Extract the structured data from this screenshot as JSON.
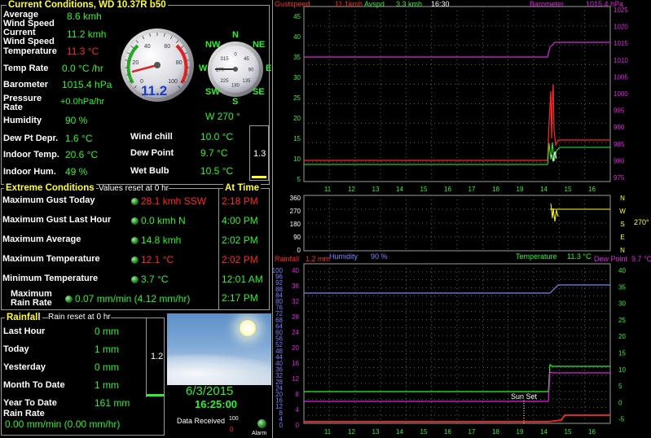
{
  "current": {
    "title": "Current Conditions, WD 10.37R b50",
    "avg_wind_label": "Average\nWind Speed",
    "avg_wind_value": "8.6 kmh",
    "cur_wind_label": "Current\nWind Speed",
    "cur_wind_value": "11.2 kmh",
    "temp_label": "Temperature",
    "temp_value": "11.3 °C",
    "temp_rate_label": "Temp Rate",
    "temp_rate_value": "0.0 °C /hr",
    "baro_label": "Barometer",
    "baro_value": "1015.4 hPa",
    "press_rate_label": "Pressure\nRate",
    "press_rate_value": "+0.0hPa/hr",
    "humidity_label": "Humidity",
    "humidity_value": "90 %",
    "wind_dir_value": "W  270 °",
    "dewdep_label": "Dew Pt Depr.",
    "dewdep_value": "1.6 °C",
    "windchill_label": "Wind chill",
    "windchill_value": "10.0 °C",
    "indoortemp_label": "Indoor Temp.",
    "indoortemp_value": "20.6 °C",
    "dewpoint_label": "Dew Point",
    "dewpoint_value": "9.7 °C",
    "indoorhum_label": "Indoor Hum.",
    "indoorhum_value": "49 %",
    "wetbulb_label": "Wet Bulb",
    "wetbulb_value": "10.5 °C",
    "bar_value": "1.3",
    "speed_gauge": {
      "value": "11.2",
      "reading": 11.2,
      "ticks": [
        "0",
        "20",
        "40",
        "60",
        "80",
        "100"
      ]
    },
    "compass": {
      "dirs": [
        "N",
        "NE",
        "E",
        "SE",
        "S",
        "SW",
        "W",
        "NW"
      ],
      "ticks": [
        "0",
        "45",
        "90",
        "135",
        "180",
        "225",
        "270",
        "315"
      ],
      "bearing": 270
    }
  },
  "extremes": {
    "title": "Extreme Conditions",
    "subtitle": "Values reset at 0 hr",
    "at_time": "At Time",
    "rows": [
      {
        "label": "Maximum Gust Today",
        "value": "28.1 kmh SSW",
        "time": "2:18 PM",
        "red": true
      },
      {
        "label": "Maximum Gust Last Hour",
        "value": "0.0 kmh  N",
        "time": "4:00 PM",
        "red": false
      },
      {
        "label": "Maximum Average",
        "value": "14.8 kmh",
        "time": "2:02 PM",
        "red": false
      },
      {
        "label": "Maximum Temperature",
        "value": "12.1 °C",
        "time": "2:02 PM",
        "red": true
      },
      {
        "label": "Minimum Temperature",
        "value": "3.7 °C",
        "time": "12:01 AM",
        "red": false
      },
      {
        "label": "Maximum\nRain Rate",
        "value": "0.07 mm/min (4.12 mm/hr)",
        "time": "2:17 PM",
        "red": false
      }
    ]
  },
  "rainfall": {
    "title": "Rainfall",
    "subtitle": "Rain reset at 0 hr",
    "rows": [
      {
        "label": "Last Hour",
        "value": "0 mm"
      },
      {
        "label": "Today",
        "value": "1 mm"
      },
      {
        "label": "Yesterday",
        "value": "0 mm"
      },
      {
        "label": "Month To Date",
        "value": "1 mm"
      },
      {
        "label": "Year To Date",
        "value": "161 mm"
      }
    ],
    "rate_label": "Rain Rate",
    "rate_value": "0.00 mm/min (0.00 mm/hr)",
    "bar_value": "1.2"
  },
  "status": {
    "date": "6/3/2015",
    "time": "16:25:00",
    "data_received_label": "Data Received",
    "data_received_count": "100",
    "data_received_zero": "0",
    "alarm_label": "Alarm"
  },
  "graphs": {
    "hours": [
      "11",
      "12",
      "13",
      "14",
      "15",
      "16",
      "17",
      "18",
      "19",
      "14",
      "15",
      "16"
    ],
    "top": {
      "gust_label": "Gustspeed",
      "gust_value": "11.1kmh",
      "avg_label": "Avspd",
      "avg_value": "3.3 kmh",
      "time": "16:30",
      "baro_label": "Barometer",
      "baro_value": "1015.4 hPa",
      "left_ticks": [
        "45",
        "40",
        "35",
        "30",
        "25",
        "20",
        "15",
        "10",
        "5"
      ],
      "right_ticks": [
        "1025",
        "1020",
        "1015",
        "1010",
        "1005",
        "1000",
        "995",
        "990",
        "985",
        "980",
        "975"
      ]
    },
    "mid": {
      "left_ticks": [
        "360",
        "270",
        "180",
        "90",
        "0"
      ],
      "right_letters": [
        "N",
        "W",
        "S",
        "E",
        "N"
      ],
      "dir_value": "270°"
    },
    "bottom": {
      "rain_label": "Rainfall",
      "rain_value": "1.2 mm",
      "hum_label": "Humidity",
      "hum_value": "90 %",
      "temp_label": "Temperature",
      "temp_value": "11.3 °C",
      "dew_label": "Dew Point",
      "dew_value": "9.7 °C",
      "left_ticks": [
        "100",
        "96",
        "92",
        "88",
        "84",
        "80",
        "76",
        "72",
        "68",
        "64",
        "60",
        "56",
        "52",
        "48",
        "44",
        "40",
        "36",
        "32",
        "28",
        "24",
        "20",
        "16",
        "12",
        "8",
        "4",
        "0"
      ],
      "mid_ticks": [
        "40",
        "36",
        "32",
        "28",
        "24",
        "20",
        "16",
        "12",
        "8",
        "4",
        "0"
      ],
      "right_ticks": [
        "40",
        "35",
        "30",
        "25",
        "20",
        "15",
        "10",
        "5",
        "0",
        "-5"
      ],
      "sunset_label": "Sun Set"
    }
  },
  "colors": {
    "green": "#2df12d",
    "red": "#ff2828",
    "magenta": "#e020e0",
    "yellow": "#ffff30",
    "violet": "#8080ff"
  }
}
